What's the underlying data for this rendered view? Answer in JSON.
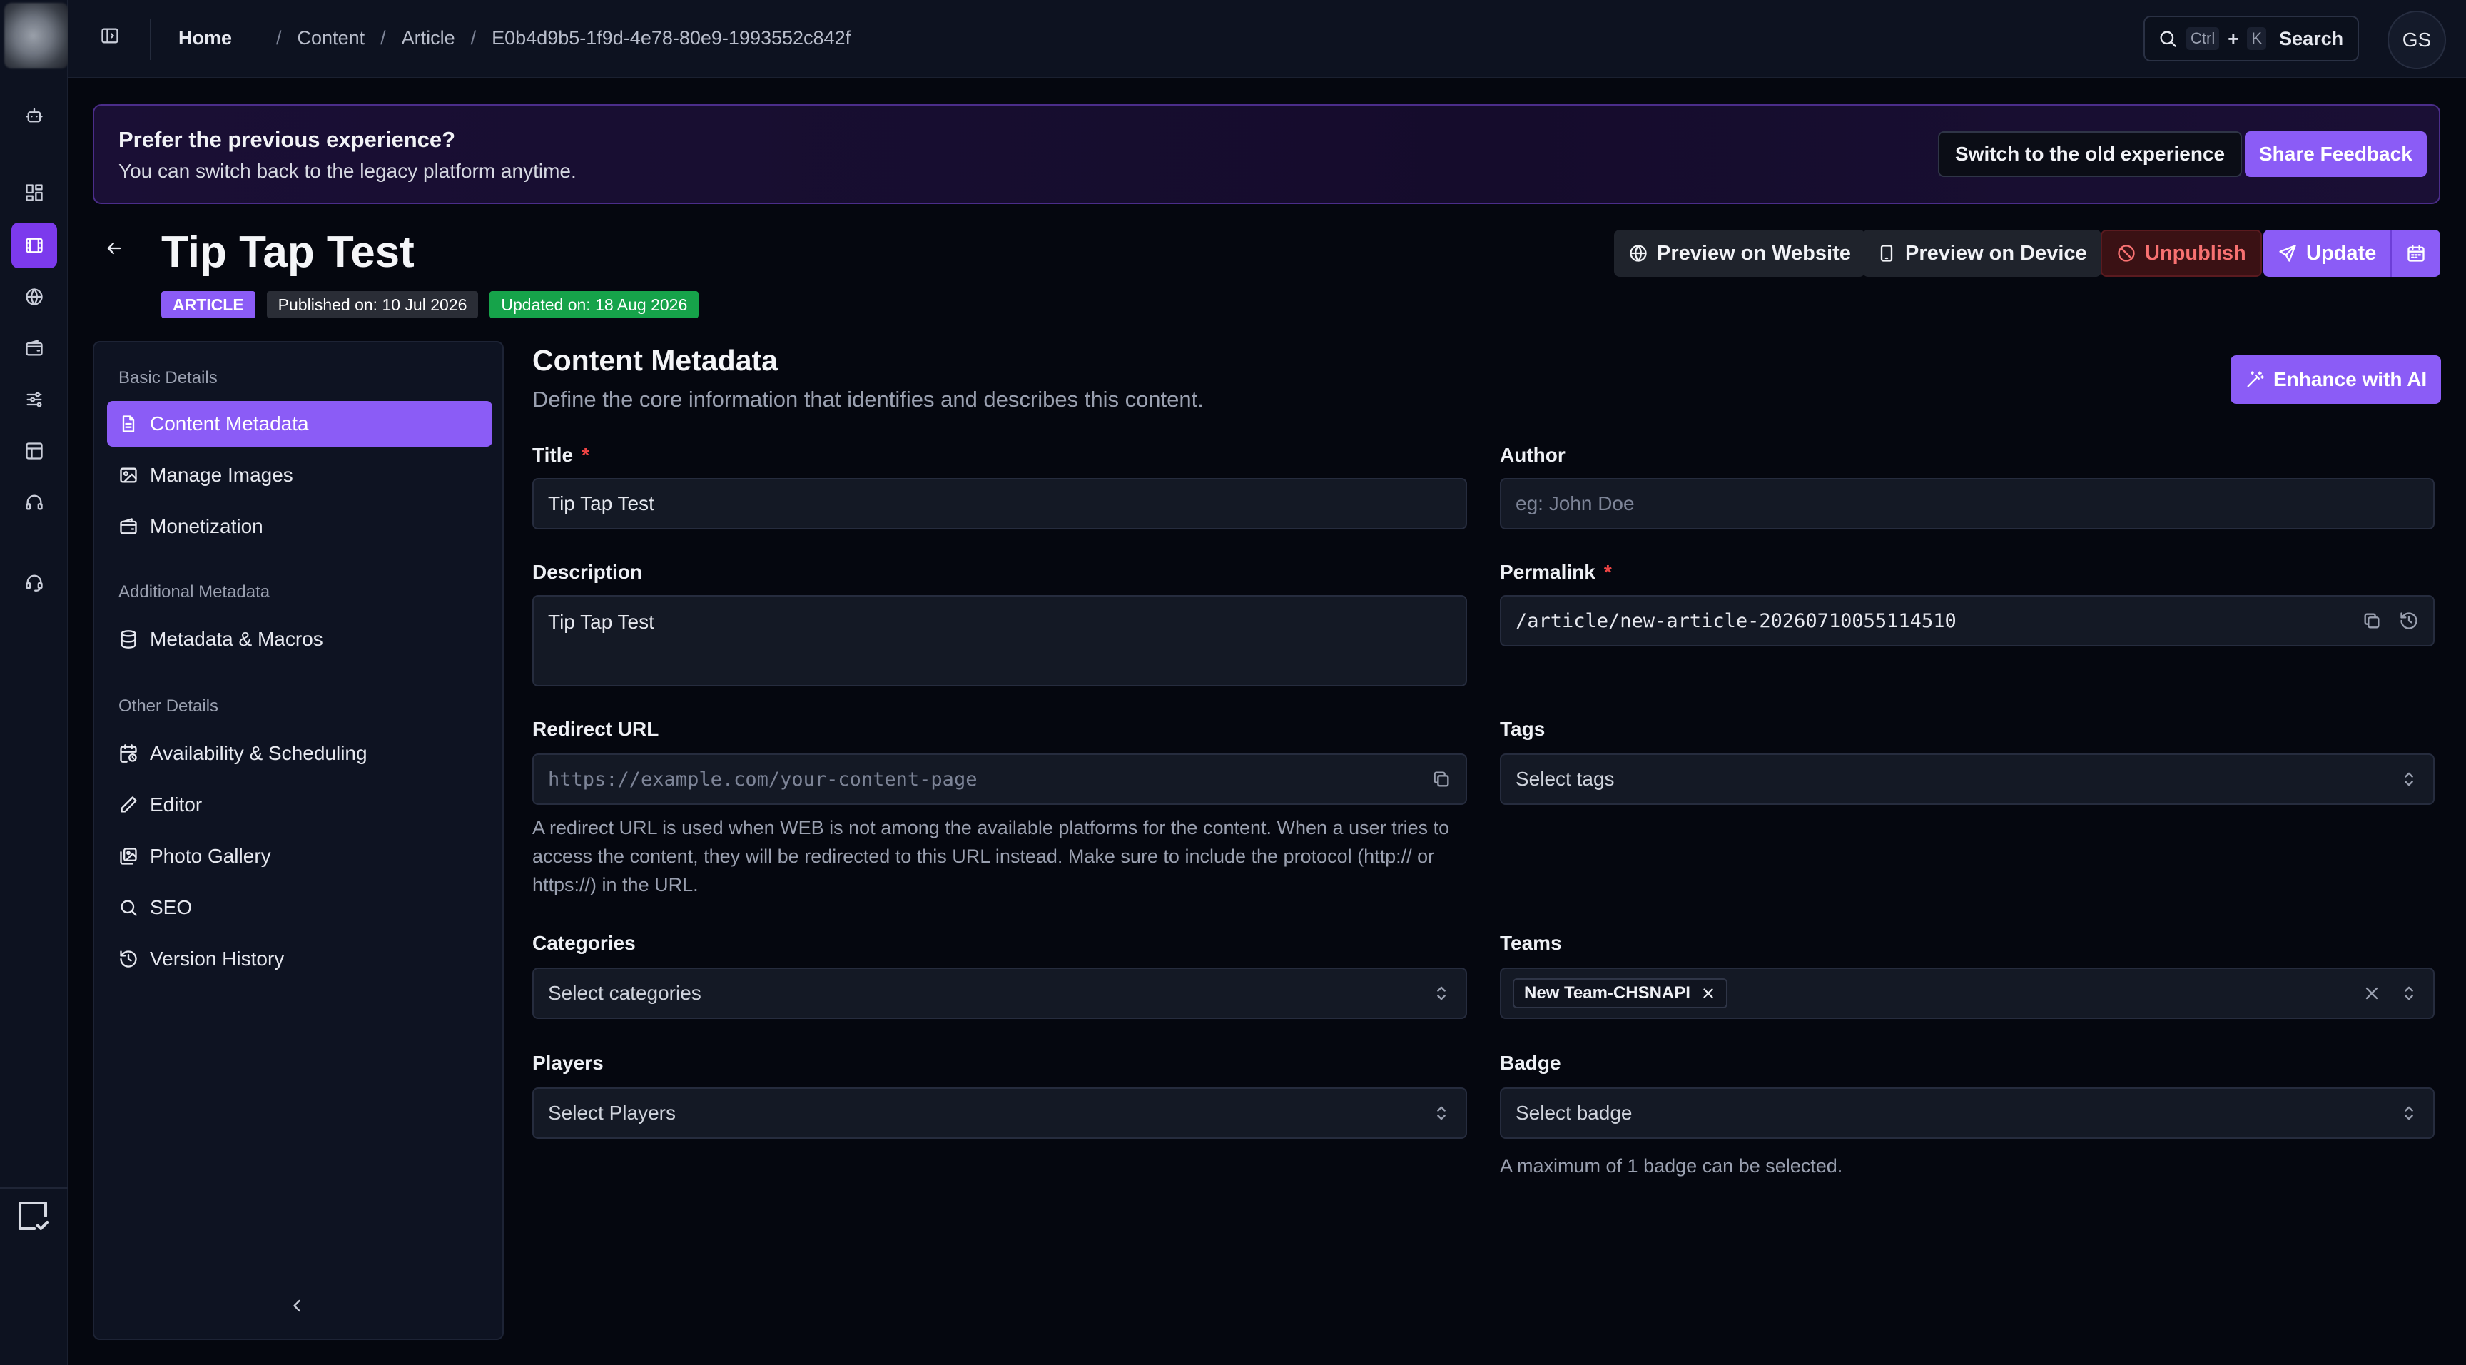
{
  "colors": {
    "accent": "#8b5cf6",
    "danger": "#f87171",
    "success": "#16a34a",
    "bg": "#05070f"
  },
  "topbar": {
    "breadcrumb": [
      "Home",
      "Content",
      "Article",
      "E0b4d9b5-1f9d-4e78-80e9-1993552c842f"
    ],
    "search": {
      "key1": "Ctrl",
      "plus": "+",
      "key2": "K",
      "label": "Search"
    },
    "avatar_initials": "GS"
  },
  "banner": {
    "title": "Prefer the previous experience?",
    "text": "You can switch back to the legacy platform anytime.",
    "switch_label": "Switch to the old experience",
    "feedback_label": "Share Feedback"
  },
  "header": {
    "title": "Tip Tap Test",
    "type_badge": "ARTICLE",
    "published": "Published on: 10 Jul 2026",
    "updated": "Updated on: 18 Aug 2026",
    "preview_web": "Preview on Website",
    "preview_device": "Preview on Device",
    "unpublish": "Unpublish",
    "update": "Update"
  },
  "sidebar": {
    "groups": [
      {
        "label": "Basic Details",
        "items": [
          "Content Metadata",
          "Manage Images",
          "Monetization"
        ]
      },
      {
        "label": "Additional Metadata",
        "items": [
          "Metadata & Macros"
        ]
      },
      {
        "label": "Other Details",
        "items": [
          "Availability & Scheduling",
          "Editor",
          "Photo Gallery",
          "SEO",
          "Version History"
        ]
      }
    ]
  },
  "main": {
    "title": "Content Metadata",
    "subtitle": "Define the core information that identifies and describes this content.",
    "ai_button": "Enhance with AI",
    "fields": {
      "title": {
        "label": "Title",
        "value": "Tip Tap Test"
      },
      "author": {
        "label": "Author",
        "placeholder": "eg: John Doe"
      },
      "description": {
        "label": "Description",
        "value": "Tip Tap Test"
      },
      "permalink": {
        "label": "Permalink",
        "value": "/article/new-article-20260710055114510"
      },
      "redirect": {
        "label": "Redirect URL",
        "placeholder": "https://example.com/your-content-page",
        "help": "A redirect URL is used when WEB is not among the available platforms for the content. When a user tries to access the content, they will be redirected to this URL instead. Make sure to include the protocol (http:// or https://) in the URL."
      },
      "tags": {
        "label": "Tags",
        "placeholder": "Select tags"
      },
      "categories": {
        "label": "Categories",
        "placeholder": "Select categories"
      },
      "teams": {
        "label": "Teams",
        "selected": "New Team-CHSNAPI"
      },
      "players": {
        "label": "Players",
        "placeholder": "Select Players"
      },
      "badge": {
        "label": "Badge",
        "placeholder": "Select badge",
        "help": "A maximum of 1 badge can be selected."
      }
    }
  }
}
